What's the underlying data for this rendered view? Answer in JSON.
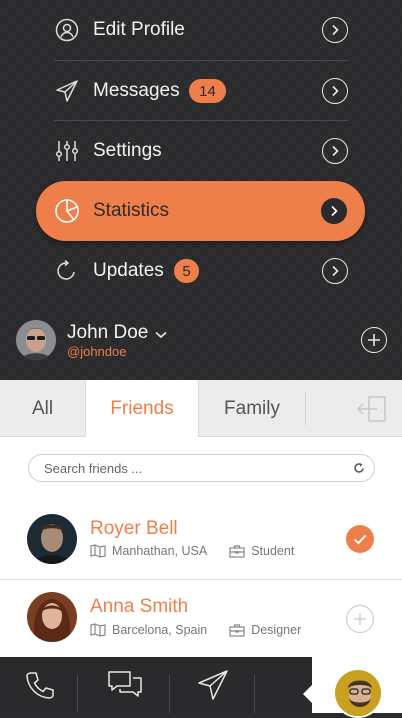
{
  "menu": {
    "items": [
      {
        "label": "Edit Profile",
        "icon": "user-icon"
      },
      {
        "label": "Messages",
        "icon": "paper-plane-icon",
        "badge": "14"
      },
      {
        "label": "Settings",
        "icon": "sliders-icon"
      },
      {
        "label": "Statistics",
        "icon": "pie-chart-icon",
        "active": true
      },
      {
        "label": "Updates",
        "icon": "refresh-icon",
        "badge": "5"
      }
    ]
  },
  "profile": {
    "name": "John Doe",
    "handle": "@johndoe"
  },
  "tabs": [
    "All",
    "Friends",
    "Family"
  ],
  "active_tab": "Friends",
  "search": {
    "placeholder": "Search friends ..."
  },
  "friends": [
    {
      "name": "Royer Bell",
      "location": "Manhathan, USA",
      "role": "Student",
      "added": true
    },
    {
      "name": "Anna Smith",
      "location": "Barcelona, Spain",
      "role": "Designer",
      "added": false
    }
  ],
  "colors": {
    "accent": "#ef7f4a",
    "dark": "#2a2a2c",
    "light_bg": "#ececec"
  }
}
